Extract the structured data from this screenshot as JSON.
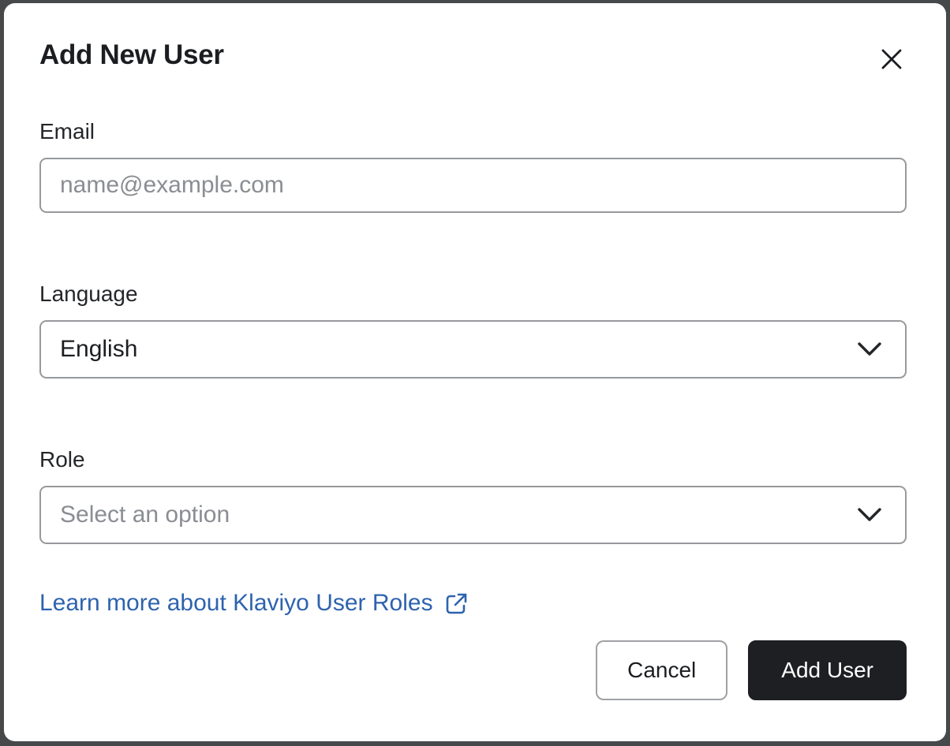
{
  "dialog": {
    "title": "Add New User"
  },
  "fields": {
    "email": {
      "label": "Email",
      "value": "",
      "placeholder": "name@example.com"
    },
    "language": {
      "label": "Language",
      "selected_value": "English"
    },
    "role": {
      "label": "Role",
      "placeholder": "Select an option"
    }
  },
  "link": {
    "label": "Learn more about Klaviyo User Roles"
  },
  "footer": {
    "cancel_label": "Cancel",
    "submit_label": "Add User"
  },
  "colors": {
    "backdrop": "#47484a",
    "link_blue": "#2e63ae",
    "primary_button_bg": "#1d1f22",
    "input_border": "#97999c",
    "placeholder_gray": "#8a8d92",
    "text_dark": "#1b1d21"
  }
}
